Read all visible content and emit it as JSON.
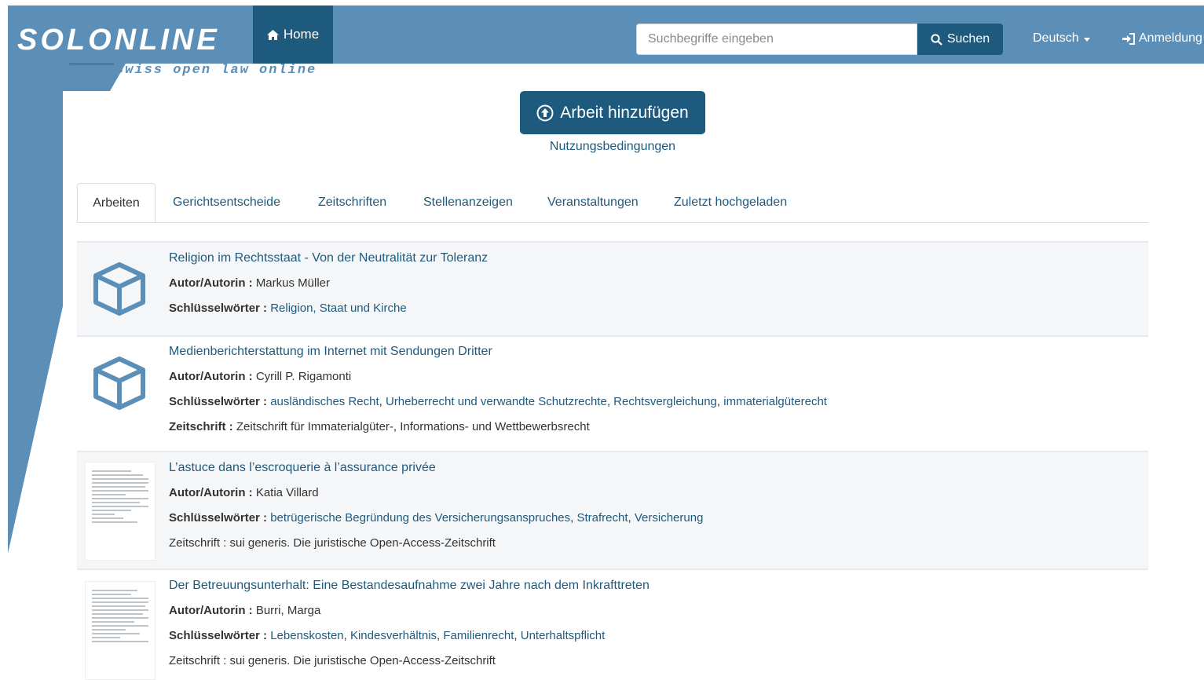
{
  "logo": {
    "title": "SOLONLINE",
    "tagline": "swiss open law online"
  },
  "nav": {
    "home_label": "Home",
    "search_placeholder": "Suchbegriffe eingeben",
    "search_button": "Suchen",
    "language": "Deutsch",
    "login": "Anmeldung"
  },
  "actions": {
    "add_work": "Arbeit hinzufügen",
    "terms": "Nutzungsbedingungen"
  },
  "tabs": [
    {
      "label": "Arbeiten",
      "active": true
    },
    {
      "label": "Gerichtsentscheide"
    },
    {
      "label": "Zeitschriften"
    },
    {
      "label": "Stellenanzeigen"
    },
    {
      "label": "Veranstaltungen"
    },
    {
      "label": "Zuletzt hochgeladen"
    }
  ],
  "labels": {
    "author": "Autor/Autorin :",
    "keywords": "Schlüsselwörter :",
    "journal": "Zeitschrift :"
  },
  "items": [
    {
      "title": "Religion im Rechtsstaat - Von der Neutralität zur Toleranz",
      "author": "Markus Müller",
      "keywords": [
        "Religion, Staat und Kirche"
      ],
      "journal": "",
      "thumb": "box-icon"
    },
    {
      "title": "Medienberichterstattung im Internet mit Sendungen Dritter",
      "author": "Cyrill P. Rigamonti",
      "keywords": [
        "ausländisches Recht",
        "Urheberrecht und verwandte Schutzrechte",
        "Rechtsvergleichung",
        "immaterialgüterecht"
      ],
      "journal": "Zeitschrift für Immaterialgüter-, Informations- und Wettbewerbsrecht",
      "thumb": "box-icon"
    },
    {
      "title": "L’astuce dans l’escroquerie à l’assurance privée",
      "author": "Katia Villard",
      "keywords": [
        "betrügerische Begründung des Versicherungsanspruches",
        "Strafrecht",
        "Versicherung"
      ],
      "journal": "sui generis. Die juristische Open-Access-Zeitschrift",
      "thumb": "document-preview"
    },
    {
      "title": "Der Betreuungsunterhalt: Eine Bestandesaufnahme zwei Jahre nach dem Inkrafttreten",
      "author": "Burri, Marga",
      "keywords": [
        "Lebenskosten",
        "Kindesverhältnis",
        "Familienrecht",
        "Unterhaltspflicht"
      ],
      "journal": "sui generis. Die juristische Open-Access-Zeitschrift",
      "thumb": "document-preview"
    }
  ],
  "colors": {
    "nav_bg": "#5b8fb7",
    "accent": "#1e5a7e",
    "link": "#1e5a7e"
  }
}
